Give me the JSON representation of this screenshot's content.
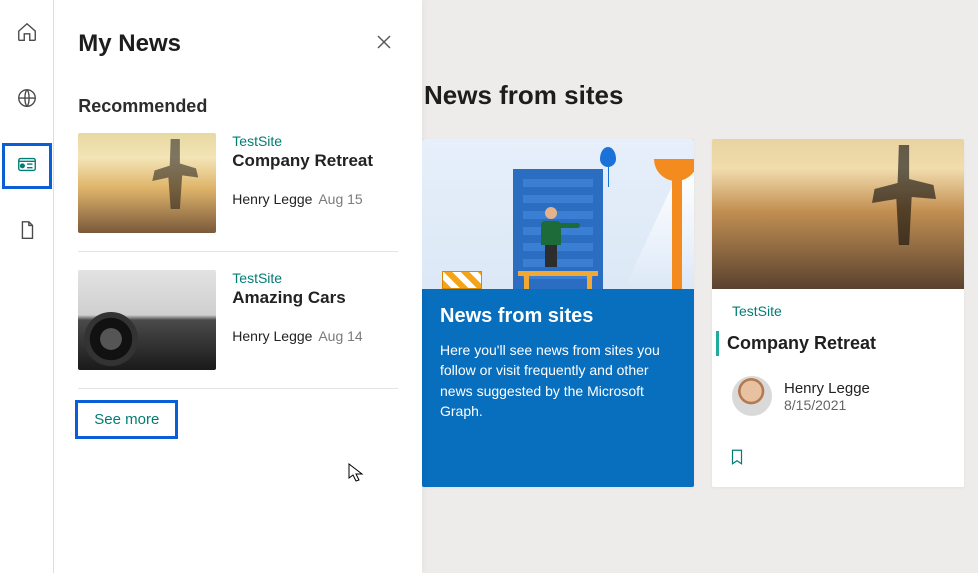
{
  "rail": {
    "home": "home-icon",
    "globe": "globe-icon",
    "news": "news-icon",
    "file": "file-icon"
  },
  "flyout": {
    "title": "My News",
    "section_label": "Recommended",
    "see_more": "See more",
    "items": [
      {
        "site": "TestSite",
        "title": "Company Retreat",
        "author": "Henry Legge",
        "date": "Aug 15"
      },
      {
        "site": "TestSite",
        "title": "Amazing Cars",
        "author": "Henry Legge",
        "date": "Aug 14"
      }
    ]
  },
  "main": {
    "heading": "News from sites",
    "info_card": {
      "title": "News from sites",
      "text": "Here you'll see news from sites you follow or visit frequently and other news suggested by the Microsoft Graph."
    },
    "news_card": {
      "site": "TestSite",
      "title": "Company Retreat",
      "author": "Henry Legge",
      "date": "8/15/2021"
    }
  }
}
